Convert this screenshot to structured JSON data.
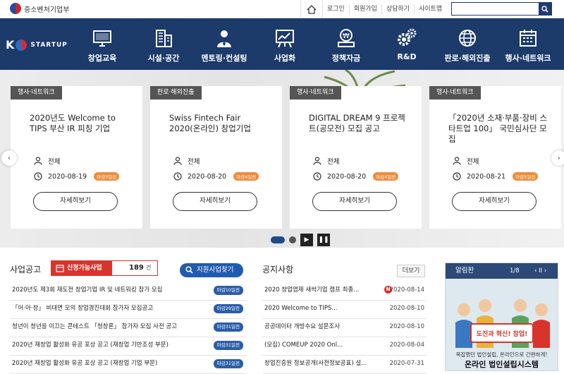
{
  "header": {
    "ministry": "중소벤처기업부",
    "links": [
      "로그인",
      "회원가입",
      "상담하기",
      "사이트맵"
    ],
    "search_placeholder": ""
  },
  "logo": {
    "k": "K",
    "text": "STARTUP"
  },
  "menu": [
    {
      "label": "창업교육",
      "icon": "monitor-icon"
    },
    {
      "label": "시설·공간",
      "icon": "building-icon"
    },
    {
      "label": "멘토링·컨설팅",
      "icon": "mentor-icon"
    },
    {
      "label": "사업화",
      "icon": "chart-board-icon"
    },
    {
      "label": "정책자금",
      "icon": "money-icon"
    },
    {
      "label": "R&D",
      "icon": "gears-icon"
    },
    {
      "label": "판로·해외진출",
      "icon": "globe-icon"
    },
    {
      "label": "행사·네트워크",
      "icon": "calendar-icon"
    }
  ],
  "cards": [
    {
      "tag": "행사·네트워크",
      "title": "2020년도 Welcome to TIPS 부산 IR 피칭 기업",
      "target": "전체",
      "date": "2020-08-19",
      "badge": "마감3일전",
      "more": "자세히보기"
    },
    {
      "tag": "판로·해외진출",
      "title": "Swiss Fintech Fair 2020(온라인) 창업기업",
      "target": "전체",
      "date": "2020-08-20",
      "badge": "마감4일전",
      "more": "자세히보기"
    },
    {
      "tag": "행사·네트워크",
      "title": "DIGITAL DREAM 9 프로젝트(공모전) 모집 공고",
      "target": "전체",
      "date": "2020-08-20",
      "badge": "마감4일전",
      "more": "자세히보기"
    },
    {
      "tag": "행사·네트워크",
      "title": "「2020년 소재·부품·장비 스타트업 100」 국민심사단 모집",
      "target": "전체",
      "date": "2020-08-21",
      "badge": "마감5일전",
      "more": "자세히보기"
    }
  ],
  "biz": {
    "title": "사업공고",
    "apply_label": "신청가능사업",
    "count": "189",
    "count_unit": "건",
    "find_label": "지원사업찾기",
    "items": [
      {
        "text": "2020년도 제3회 재도전 창업기업 IR 및 네트워킹 참가 모집",
        "deadline": "마감10일전"
      },
      {
        "text": "「어·아·창」 비대면 모의 창업경진대회 참가자 모집공고",
        "deadline": "마감29일전"
      },
      {
        "text": "청년이 청년을 이끄는 콘테스트 「청창론」 참가자 모집 사전 공고",
        "deadline": "마감31일전"
      },
      {
        "text": "2020년 재창업 활성화 유공 포상 공고 (재창업 기반조성 부문)",
        "deadline": "마감31일전"
      },
      {
        "text": "2020년 재창업 활성화 유공 포상 공고 (재창업 기업 부문)",
        "deadline": "마감31일전"
      }
    ]
  },
  "notice": {
    "title": "공지사항",
    "more": "더보기",
    "items": [
      {
        "text": "2020 창업염재 새싹기업 캠프 최종...",
        "date": "2020-08-14",
        "new": "N"
      },
      {
        "text": "2020 Welcome to TIPS...",
        "date": "2020-08-10",
        "new": ""
      },
      {
        "text": "공공데이터 개방수요 설문조사",
        "date": "2020-08-10",
        "new": ""
      },
      {
        "text": "(모집) COMEUP 2020 Onl...",
        "date": "2020-08-04",
        "new": ""
      },
      {
        "text": "창업진흥원 정보공개(사전정보공표) 설...",
        "date": "2020-07-31",
        "new": ""
      }
    ]
  },
  "board": {
    "title": "알림판",
    "page": "1/8",
    "controls": "‹  ⅠⅠ  ›",
    "banner_text": "도전과 혁신! 창업!",
    "sub": "복잡했던 법인설립, 온라인으로 간편하게!",
    "big": "온라인 법인설립시스템"
  },
  "colors": {
    "nav": "#1c3a6a",
    "accent": "#d9342c",
    "badge": "#f08a3a",
    "deadline": "#2b5ea8"
  }
}
